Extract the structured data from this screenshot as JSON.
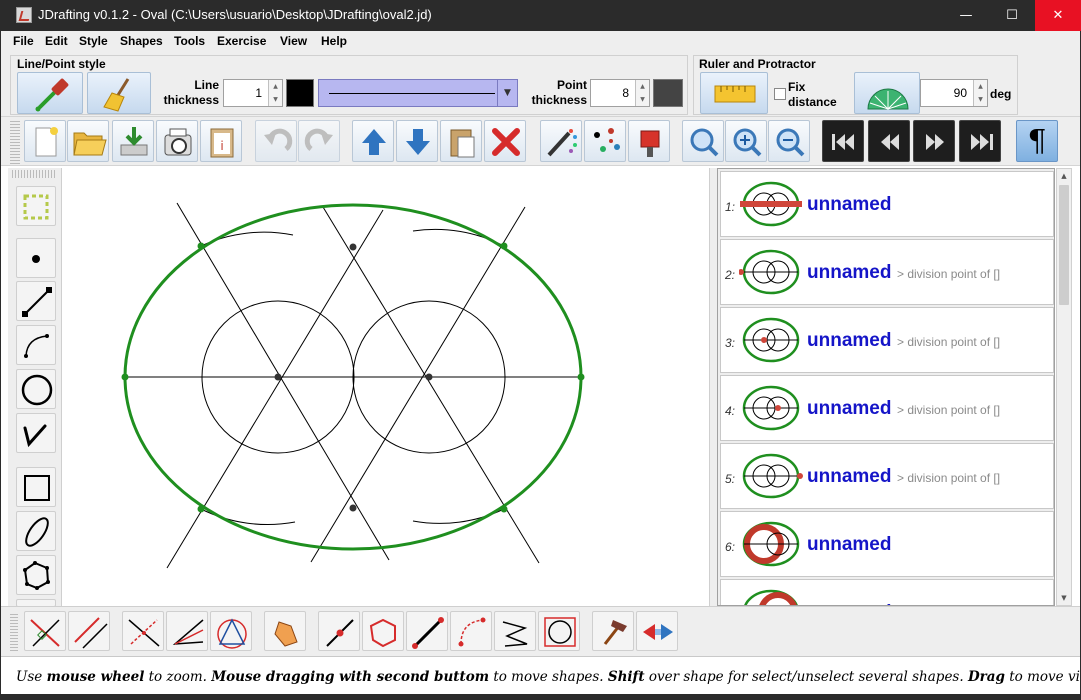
{
  "window": {
    "app_name": "JDrafting",
    "title": "JDrafting   v0.1.2 - Oval (C:\\Users\\usuario\\Desktop\\JDrafting\\oval2.jd)",
    "minimize": "—",
    "maximize": "☐",
    "close": "✕"
  },
  "menu": [
    "File",
    "Edit",
    "Style",
    "Shapes",
    "Tools",
    "Exercise",
    "View",
    "Help"
  ],
  "line_point_style": {
    "title": "Line/Point style",
    "line_thickness_label_1": "Line",
    "line_thickness_label_2": "thickness",
    "line_thickness_value": "1",
    "line_color": "#000000",
    "point_thickness_label_1": "Point",
    "point_thickness_label_2": "thickness",
    "point_thickness_value": "8",
    "point_color": "#444444"
  },
  "ruler_protractor": {
    "title": "Ruler and Protractor",
    "fix_distance_label_1": "Fix",
    "fix_distance_label_2": "distance",
    "fix_distance_checked": false,
    "angle_value": "90",
    "angle_unit": "deg"
  },
  "toolbar_icons": [
    "new-file-icon",
    "open-folder-icon",
    "save-icon",
    "print-preview-icon",
    "clipboard-info-icon",
    "undo-icon",
    "redo-icon",
    "move-up-icon",
    "move-down-icon",
    "paste-icon",
    "delete-icon",
    "palette-pencil-icon",
    "points-color-icon",
    "paint-bucket-icon",
    "zoom-fit-icon",
    "zoom-in-icon",
    "zoom-out-icon",
    "first-step-icon",
    "previous-step-icon",
    "next-step-icon",
    "last-step-icon",
    "pilcrow-icon"
  ],
  "pilcrow": "¶",
  "shapes_list": [
    {
      "num": "1:",
      "name": "unnamed",
      "desc": "",
      "thumb_color": "#d0463a"
    },
    {
      "num": "2:",
      "name": "unnamed",
      "desc": "> division point of []",
      "thumb_color": "#d0463a"
    },
    {
      "num": "3:",
      "name": "unnamed",
      "desc": "> division point of []",
      "thumb_color": "#d0463a"
    },
    {
      "num": "4:",
      "name": "unnamed",
      "desc": "> division point of []",
      "thumb_color": "#d0463a"
    },
    {
      "num": "5:",
      "name": "unnamed",
      "desc": "> division point of []",
      "thumb_color": "#d0463a"
    },
    {
      "num": "6:",
      "name": "unnamed",
      "desc": "",
      "thumb_color": "#c0392b"
    },
    {
      "num": "",
      "name": "unnamed",
      "desc": "",
      "thumb_color": "#c0392b"
    }
  ],
  "colors": {
    "oval": "#1f8f1f",
    "construction": "#000000",
    "point": "#333333",
    "list_name": "#1515c8"
  },
  "status": {
    "t1": "Use ",
    "b1": "mouse wheel",
    "t2": " to zoom. ",
    "b2": "Mouse dragging with second buttom",
    "t3": " to move shapes. ",
    "b3": "Shift",
    "t4": " over shape for select/unselect several shapes. ",
    "b4": "Drag",
    "t5": " to move viewport"
  }
}
